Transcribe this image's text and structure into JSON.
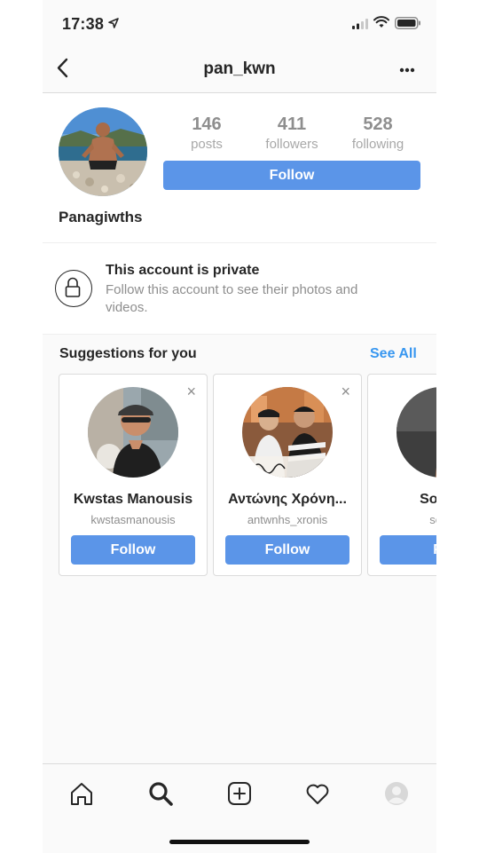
{
  "status_bar": {
    "time": "17:38"
  },
  "header": {
    "username": "pan_kwn"
  },
  "profile": {
    "display_name": "Panagiwths",
    "stats": [
      {
        "value": "146",
        "label": "posts"
      },
      {
        "value": "411",
        "label": "followers"
      },
      {
        "value": "528",
        "label": "following"
      }
    ],
    "follow_label": "Follow"
  },
  "private_notice": {
    "title": "This account is private",
    "text": "Follow this account to see their photos and videos."
  },
  "suggestions": {
    "title": "Suggestions for you",
    "see_all": "See All",
    "cards": [
      {
        "name": "Kwstas Manousis",
        "handle": "kwstasmanousis",
        "follow": "Follow",
        "close": "×"
      },
      {
        "name": "Αντώνης Χρόνη...",
        "handle": "antwnhs_xronis",
        "follow": "Follow",
        "close": "×"
      },
      {
        "name": "Sotiris",
        "handle": "sotiri",
        "follow": "Fo",
        "close": "×"
      }
    ]
  },
  "tab_bar": {
    "icons": [
      "home-icon",
      "search-icon",
      "new-post-icon",
      "activity-heart-icon",
      "profile-avatar-icon"
    ]
  },
  "colors": {
    "accent": "#5b95e8",
    "link": "#3897f0",
    "text": "#262626",
    "muted": "#8e8e8e"
  }
}
